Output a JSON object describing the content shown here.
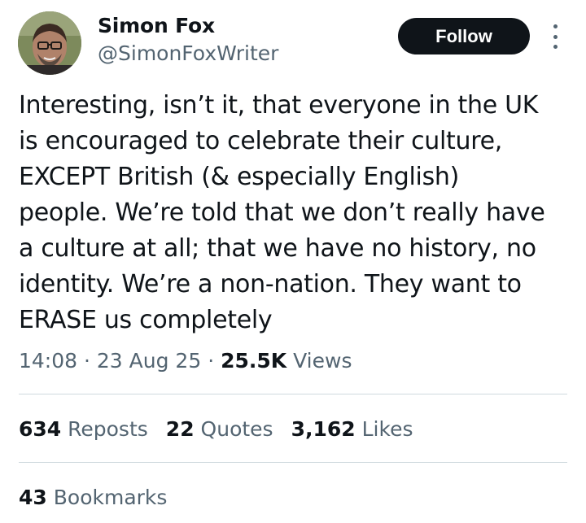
{
  "author": {
    "name": "Simon Fox",
    "handle": "@SimonFoxWriter",
    "avatar_icon": "user-avatar-photo"
  },
  "header": {
    "follow_label": "Follow",
    "more_icon": "vertical-ellipsis-icon"
  },
  "post": {
    "text": "Interesting, isn’t it, that everyone in the UK\nis encouraged to celebrate their culture,\nEXCEPT British (& especially English)\npeople. We’re told that we don’t really have\na culture at all; that we have no history, no\nidentity. We’re a non-nation. They want to\nERASE us completely"
  },
  "meta": {
    "time": "14:08",
    "sep1": "·",
    "date": "23 Aug 25",
    "sep2": "·",
    "views_count": "25.5K",
    "views_label": "Views"
  },
  "stats": {
    "reposts_count": "634",
    "reposts_label": "Reposts",
    "quotes_count": "22",
    "quotes_label": "Quotes",
    "likes_count": "3,162",
    "likes_label": "Likes",
    "bookmarks_count": "43",
    "bookmarks_label": "Bookmarks"
  },
  "colors": {
    "text": "#0f1419",
    "secondary": "#536471",
    "divider": "#cfd9de",
    "button_bg": "#0f1419",
    "button_text": "#ffffff"
  }
}
